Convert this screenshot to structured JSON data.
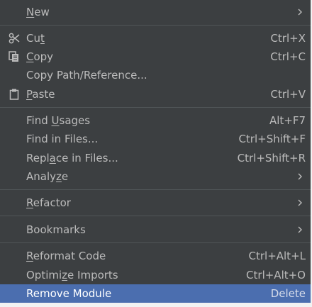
{
  "menu": {
    "new": {
      "pre": "",
      "mn": "N",
      "post": "ew"
    },
    "cut": {
      "pre": "Cu",
      "mn": "t",
      "post": "",
      "shortcut": "Ctrl+X"
    },
    "copy": {
      "pre": "",
      "mn": "C",
      "post": "opy",
      "shortcut": "Ctrl+C"
    },
    "copy_path": {
      "label": "Copy Path/Reference..."
    },
    "paste": {
      "pre": "",
      "mn": "P",
      "post": "aste",
      "shortcut": "Ctrl+V"
    },
    "find_usages": {
      "pre": "Find ",
      "mn": "U",
      "post": "sages",
      "shortcut": "Alt+F7"
    },
    "find_in_files": {
      "label": "Find in Files...",
      "shortcut": "Ctrl+Shift+F"
    },
    "replace_in_files": {
      "pre": "Repl",
      "mn": "a",
      "post": "ce in Files...",
      "shortcut": "Ctrl+Shift+R"
    },
    "analyze": {
      "pre": "Analy",
      "mn": "z",
      "post": "e"
    },
    "refactor": {
      "pre": "",
      "mn": "R",
      "post": "efactor"
    },
    "bookmarks": {
      "label": "Bookmarks"
    },
    "reformat_code": {
      "pre": "",
      "mn": "R",
      "post": "eformat Code",
      "shortcut": "Ctrl+Alt+L"
    },
    "optimize_imports": {
      "pre": "Optimi",
      "mn": "z",
      "post": "e Imports",
      "shortcut": "Ctrl+Alt+O"
    },
    "remove_module": {
      "label": "Remove Module",
      "shortcut": "Delete"
    }
  },
  "colors": {
    "background": "#3c3f41",
    "text": "#bbbbbb",
    "separator": "#515658",
    "selection": "#4b6eaf"
  },
  "icons": {
    "cut": "scissors-icon",
    "copy": "copy-icon",
    "paste": "clipboard-icon",
    "submenu": "chevron-right-icon"
  }
}
